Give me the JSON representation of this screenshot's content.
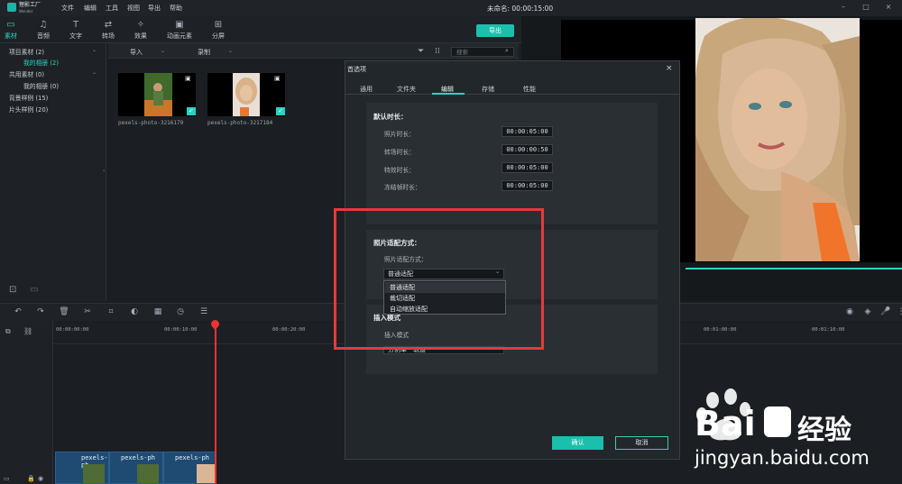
{
  "app": {
    "logo_text": "狸影工厂",
    "logo_sub": "Wonder",
    "menus": [
      "文件",
      "编辑",
      "工具",
      "视图",
      "导出",
      "帮助"
    ],
    "project_label": "未命名: 00:00:15:00",
    "colors": {
      "accent": "#1bc0ad",
      "highlight": "#e53a3a",
      "timeline_clip": "#1f4a72"
    }
  },
  "toolbar": {
    "tools": [
      {
        "label": "素材",
        "icon": "folder-icon"
      },
      {
        "label": "音频",
        "icon": "music-note-icon"
      },
      {
        "label": "文字",
        "icon": "text-icon"
      },
      {
        "label": "转场",
        "icon": "transition-icon"
      },
      {
        "label": "效果",
        "icon": "effects-icon"
      },
      {
        "label": "动画元素",
        "icon": "image-icon"
      },
      {
        "label": "分屏",
        "icon": "split-screen-icon"
      }
    ],
    "export_label": "导出"
  },
  "library": {
    "items": [
      {
        "label": "项目素材 (2)",
        "selected": false
      },
      {
        "label": "我的相册 (2)",
        "selected": true
      },
      {
        "label": "共用素材 (0)",
        "selected": false
      },
      {
        "label": "我的相册 (0)",
        "selected": false
      },
      {
        "label": "背景样例 (15)",
        "selected": false
      },
      {
        "label": "片头样例 (20)",
        "selected": false
      }
    ]
  },
  "media_bar": {
    "import_label": "导入",
    "record_label": "录制",
    "search_placeholder": "搜索"
  },
  "media": [
    {
      "name": "pexels-photo-3216179"
    },
    {
      "name": "pexels-photo-3217184"
    }
  ],
  "timeline": {
    "ticks": [
      "00:00:00:00",
      "00:00:10:00",
      "00:00:20:00",
      "00:01:00:00",
      "00:01:10:00"
    ],
    "clips": [
      "pexels-ph",
      "pexels-ph",
      "pexels-ph"
    ]
  },
  "dialog": {
    "title": "首选项",
    "tabs": [
      "通用",
      "文件夹",
      "编辑",
      "存储",
      "性能"
    ],
    "active_tab": "编辑",
    "default_duration": {
      "title": "默认时长：",
      "fields": [
        {
          "label": "照片时长：",
          "value": "00:00:05:00"
        },
        {
          "label": "转场时长：",
          "value": "00:00:00:50"
        },
        {
          "label": "特效时长：",
          "value": "00:00:05:00"
        },
        {
          "label": "冻结帧时长：",
          "value": "00:00:05:00"
        }
      ]
    },
    "photo_fit": {
      "title": "照片适配方式：",
      "label": "照片适配方式：",
      "selected": "普通适配",
      "options": [
        "普通适配",
        "裁切适配",
        "自动缩放适配"
      ]
    },
    "insert_mode": {
      "title": "插入模式",
      "label": "插入模式",
      "selected": "分割单一轨道"
    },
    "ok_label": "确认",
    "cancel_label": "取消"
  },
  "watermark": {
    "brand": "Bai",
    "brand2": "经验",
    "url": "jingyan.baidu.com"
  }
}
